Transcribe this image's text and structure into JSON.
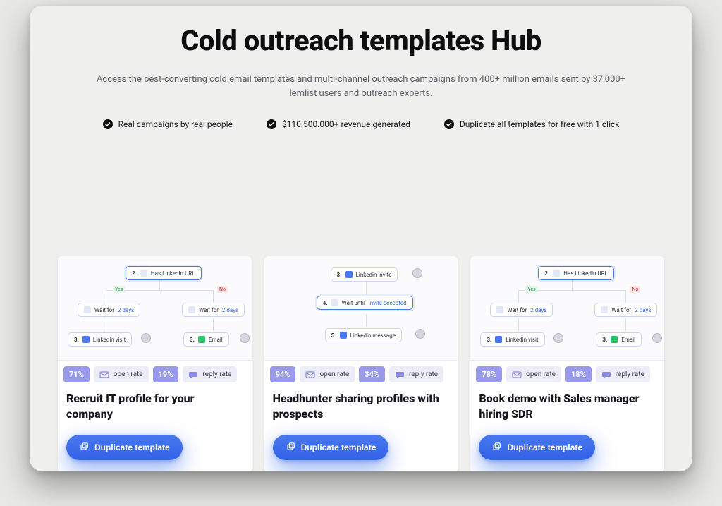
{
  "header": {
    "title": "Cold outreach templates Hub",
    "subtitle": "Access the best-converting cold email templates and multi-channel outreach campaigns from 400+ million emails sent by 37,000+ lemlist users and outreach experts."
  },
  "features": [
    "Real campaigns by real people",
    "$110.500.000+ revenue generated",
    "Duplicate all templates for free with 1 click"
  ],
  "common": {
    "open_rate_label": "open rate",
    "reply_rate_label": "reply rate",
    "duplicate_label": "Duplicate template",
    "flow": {
      "has_linkedin_url": "Has LinkedIn URL",
      "wait_for": "Wait for ",
      "two_days": "2 days",
      "linkedin_visit": "Linkedin visit",
      "email": "Email",
      "linkedin_invite": "Linkedin invite",
      "wait_until": "Wait until ",
      "invite_accepted": "invite accepted",
      "linkedin_message": "Linkedin message",
      "yes": "Yes",
      "no": "No",
      "step2": "2.",
      "step3": "3.",
      "step4": "4.",
      "step5": "5."
    }
  },
  "cards": [
    {
      "open_pct": "71%",
      "reply_pct": "19%",
      "title": "Recruit IT profile for your company"
    },
    {
      "open_pct": "94%",
      "reply_pct": "34%",
      "title": "Headhunter sharing profiles with prospects"
    },
    {
      "open_pct": "78%",
      "reply_pct": "18%",
      "title": "Book demo with Sales manager hiring SDR"
    }
  ]
}
